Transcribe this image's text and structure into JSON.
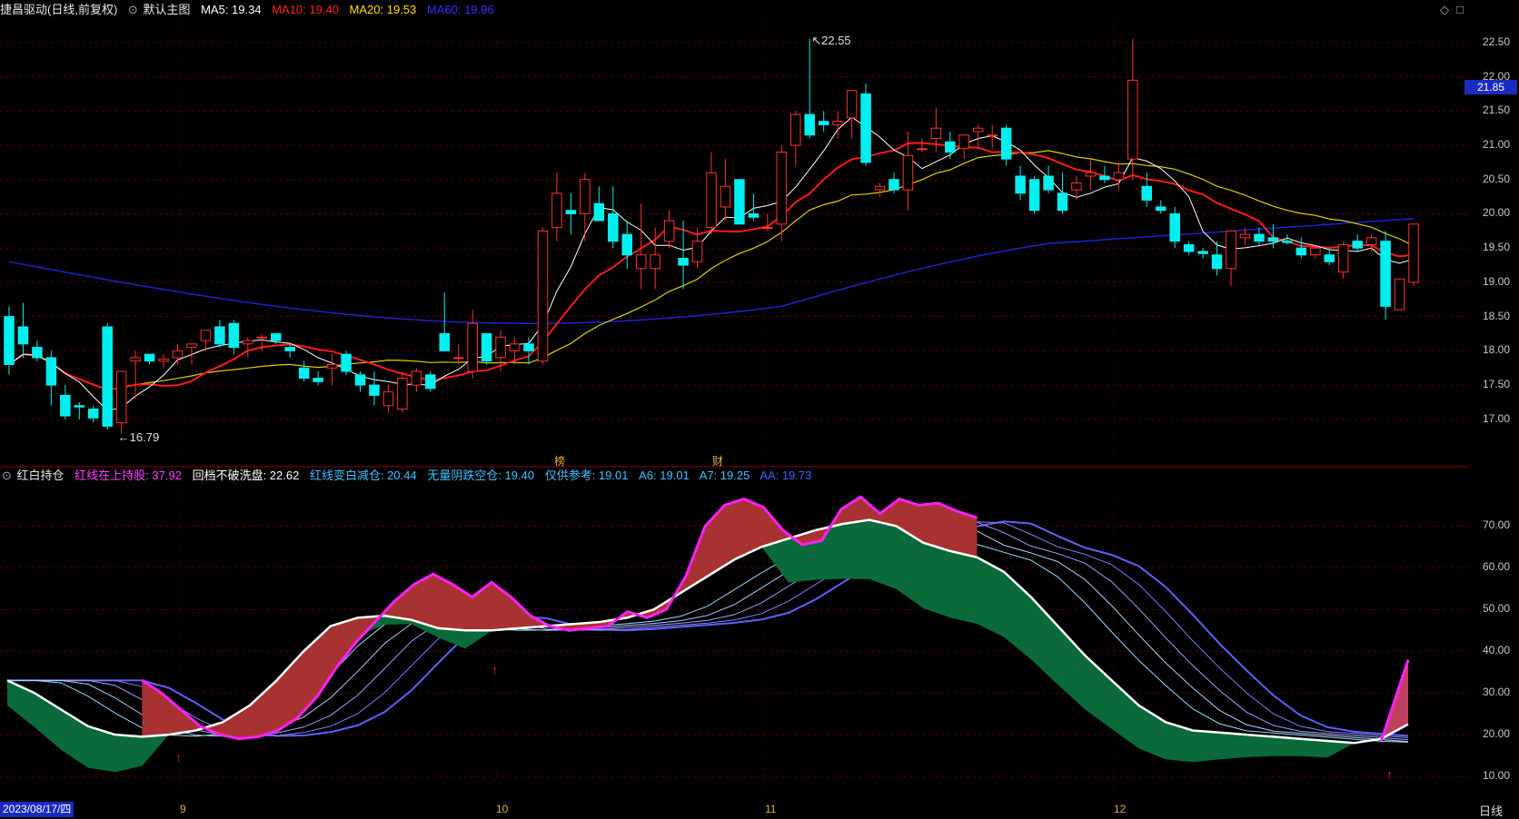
{
  "main_header": {
    "stock_title": "捷昌驱动(日线,前复权)",
    "template": "默认主图",
    "ma5": "MA5: 19.34",
    "ma10": "MA10: 19.40",
    "ma20": "MA20: 19.53",
    "ma60": "MA60: 19.96",
    "colors": {
      "ma5": "#ffffff",
      "ma10": "#ff2020",
      "ma20": "#ffe000",
      "ma60": "#3030ff"
    }
  },
  "main_axis": {
    "ticks": [
      "22.50",
      "22.00",
      "21.50",
      "21.00",
      "20.50",
      "20.00",
      "19.50",
      "19.00",
      "18.50",
      "18.00",
      "17.50",
      "17.00"
    ],
    "current_price": "21.85"
  },
  "annotations": {
    "high_label": "22.55",
    "low_label": "16.79",
    "marker_bang": "榜",
    "marker_cai": "财"
  },
  "indicator_header": {
    "name": "红白持仓",
    "hold": "红线在上持股: 37.92",
    "pullback": "回档不破洗盘: 22.62",
    "reduce": "红线变白减仓: 20.44",
    "empty": "无量阴跌空仓: 19.40",
    "ref": "仅供参考: 19.01",
    "a6": "A6: 19.01",
    "a7": "A7: 19.25",
    "aa": "AA: 19.73"
  },
  "indicator_axis": {
    "ticks": [
      "70.00",
      "60.00",
      "50.00",
      "40.00",
      "30.00",
      "20.00",
      "10.00"
    ]
  },
  "bottom_bar": {
    "date": "2023/08/17/四",
    "months": [
      "9",
      "10",
      "11",
      "12"
    ],
    "period": "日线"
  },
  "icons": [
    "diamond-icon",
    "maximize-icon",
    "settings-circle-icon",
    "up-arrow-signal-icon"
  ],
  "chart_data": {
    "type": "candlestick",
    "ylim": [
      16.6,
      22.75
    ],
    "candles": [
      [
        18.5,
        18.65,
        17.65,
        17.8
      ],
      [
        18.35,
        18.7,
        17.9,
        18.1
      ],
      [
        18.05,
        18.15,
        17.85,
        17.9
      ],
      [
        17.9,
        18.0,
        17.2,
        17.5
      ],
      [
        17.35,
        17.5,
        17.0,
        17.05
      ],
      [
        17.2,
        17.25,
        17.0,
        17.18
      ],
      [
        17.15,
        17.2,
        16.95,
        17.02
      ],
      [
        18.35,
        18.4,
        16.85,
        16.9
      ],
      [
        16.95,
        17.7,
        16.79,
        17.7
      ],
      [
        17.85,
        18.0,
        17.3,
        17.9
      ],
      [
        17.95,
        17.95,
        17.8,
        17.85
      ],
      [
        17.85,
        17.95,
        17.75,
        17.88
      ],
      [
        17.9,
        18.1,
        17.8,
        18.0
      ],
      [
        18.05,
        18.1,
        17.8,
        18.1
      ],
      [
        18.15,
        18.3,
        18.0,
        18.3
      ],
      [
        18.35,
        18.45,
        18.05,
        18.1
      ],
      [
        18.4,
        18.45,
        17.95,
        18.05
      ],
      [
        18.1,
        18.2,
        17.9,
        18.15
      ],
      [
        18.2,
        18.25,
        18.0,
        18.2
      ],
      [
        18.25,
        18.25,
        18.1,
        18.15
      ],
      [
        18.05,
        18.1,
        17.9,
        18.0
      ],
      [
        17.75,
        17.85,
        17.55,
        17.6
      ],
      [
        17.6,
        17.7,
        17.5,
        17.55
      ],
      [
        17.75,
        17.95,
        17.5,
        17.8
      ],
      [
        17.95,
        18.0,
        17.65,
        17.7
      ],
      [
        17.65,
        17.7,
        17.4,
        17.5
      ],
      [
        17.5,
        17.7,
        17.2,
        17.35
      ],
      [
        17.2,
        17.5,
        17.1,
        17.4
      ],
      [
        17.15,
        17.7,
        17.1,
        17.6
      ],
      [
        17.5,
        17.75,
        17.4,
        17.7
      ],
      [
        17.65,
        17.7,
        17.4,
        17.45
      ],
      [
        18.25,
        18.85,
        18.1,
        18.0
      ],
      [
        17.9,
        18.1,
        17.8,
        17.9
      ],
      [
        17.7,
        18.6,
        17.6,
        18.4
      ],
      [
        18.25,
        18.25,
        17.8,
        17.85
      ],
      [
        17.9,
        18.3,
        17.7,
        18.2
      ],
      [
        18.0,
        18.2,
        17.8,
        18.1
      ],
      [
        18.1,
        18.2,
        17.8,
        18.0
      ],
      [
        17.85,
        19.8,
        17.8,
        19.75
      ],
      [
        19.8,
        20.6,
        19.6,
        20.3
      ],
      [
        20.05,
        20.3,
        19.7,
        20.0
      ],
      [
        20.0,
        20.6,
        19.6,
        20.5
      ],
      [
        20.15,
        20.4,
        19.9,
        19.9
      ],
      [
        20.0,
        20.4,
        19.5,
        19.6
      ],
      [
        19.7,
        19.9,
        19.2,
        19.4
      ],
      [
        19.2,
        20.15,
        18.9,
        19.4
      ],
      [
        19.2,
        19.8,
        18.9,
        19.4
      ],
      [
        19.6,
        20.05,
        19.5,
        19.9
      ],
      [
        19.35,
        19.9,
        18.9,
        19.25
      ],
      [
        19.3,
        19.8,
        19.2,
        19.6
      ],
      [
        19.8,
        20.9,
        19.7,
        20.6
      ],
      [
        20.1,
        20.8,
        19.9,
        20.4
      ],
      [
        20.5,
        20.5,
        19.85,
        19.85
      ],
      [
        20.0,
        20.3,
        19.9,
        19.95
      ],
      [
        19.8,
        20.0,
        19.75,
        19.8
      ],
      [
        19.85,
        21.0,
        19.6,
        20.9
      ],
      [
        21.0,
        21.5,
        20.7,
        21.45
      ],
      [
        21.45,
        22.55,
        21.1,
        21.15
      ],
      [
        21.35,
        21.5,
        21.2,
        21.3
      ],
      [
        21.3,
        21.5,
        21.1,
        21.35
      ],
      [
        21.4,
        21.75,
        21.1,
        21.8
      ],
      [
        21.75,
        21.9,
        20.7,
        20.75
      ],
      [
        20.35,
        20.45,
        20.25,
        20.4
      ],
      [
        20.5,
        20.6,
        20.3,
        20.35
      ],
      [
        20.35,
        21.2,
        20.05,
        20.85
      ],
      [
        20.95,
        21.1,
        20.9,
        20.95
      ],
      [
        21.1,
        21.55,
        20.9,
        21.25
      ],
      [
        21.05,
        21.2,
        20.8,
        20.9
      ],
      [
        20.95,
        21.15,
        20.8,
        21.15
      ],
      [
        21.2,
        21.3,
        20.95,
        21.25
      ],
      [
        21.15,
        21.3,
        20.95,
        21.15
      ],
      [
        21.25,
        21.3,
        20.7,
        20.8
      ],
      [
        20.55,
        20.7,
        20.2,
        20.3
      ],
      [
        20.5,
        20.55,
        20.0,
        20.05
      ],
      [
        20.55,
        20.7,
        20.3,
        20.35
      ],
      [
        20.3,
        20.6,
        20.0,
        20.05
      ],
      [
        20.35,
        20.55,
        20.2,
        20.45
      ],
      [
        20.55,
        20.8,
        20.35,
        20.6
      ],
      [
        20.55,
        20.7,
        20.45,
        20.5
      ],
      [
        20.5,
        20.75,
        20.35,
        20.6
      ],
      [
        20.8,
        22.55,
        20.5,
        21.95
      ],
      [
        20.4,
        20.6,
        20.1,
        20.2
      ],
      [
        20.1,
        20.2,
        20.0,
        20.05
      ],
      [
        20.0,
        20.1,
        19.5,
        19.6
      ],
      [
        19.55,
        19.6,
        19.4,
        19.45
      ],
      [
        19.45,
        19.5,
        19.35,
        19.42
      ],
      [
        19.4,
        19.6,
        19.1,
        19.2
      ],
      [
        19.2,
        19.75,
        18.95,
        19.75
      ],
      [
        19.65,
        19.8,
        19.55,
        19.7
      ],
      [
        19.7,
        19.8,
        19.55,
        19.6
      ],
      [
        19.65,
        19.85,
        19.5,
        19.6
      ],
      [
        19.6,
        19.7,
        19.55,
        19.58
      ],
      [
        19.5,
        19.65,
        19.35,
        19.4
      ],
      [
        19.4,
        19.55,
        19.35,
        19.5
      ],
      [
        19.4,
        19.5,
        19.25,
        19.3
      ],
      [
        19.15,
        19.6,
        19.05,
        19.55
      ],
      [
        19.6,
        19.7,
        19.45,
        19.5
      ],
      [
        19.55,
        19.7,
        19.45,
        19.65
      ],
      [
        19.6,
        19.75,
        18.45,
        18.65
      ],
      [
        18.6,
        18.6,
        18.6,
        19.05
      ],
      [
        19.0,
        19.85,
        18.95,
        19.85
      ]
    ],
    "indicator_ylim": [
      5,
      79
    ],
    "indicator_red_line": [
      33,
      30,
      26,
      22,
      20,
      19,
      19.5,
      21,
      24,
      29,
      36,
      42,
      47,
      52,
      56,
      58.5,
      56,
      53,
      56.5,
      53,
      48.5,
      46,
      45,
      45.5,
      46,
      49.5,
      48,
      50,
      58,
      70,
      75,
      76.5,
      74.5,
      69,
      65.5,
      66.5,
      74,
      77,
      73,
      76.5,
      75,
      75.5,
      73.5,
      72
    ],
    "indicator_white_line": [
      33,
      30,
      26,
      22,
      20,
      19.5,
      20,
      21,
      23,
      27,
      33,
      40,
      46,
      48,
      48.5,
      47.5,
      45.5,
      45,
      45,
      45.5,
      46,
      46.5,
      47,
      48,
      50,
      54,
      58,
      62,
      65,
      67,
      69,
      70.5,
      71.5,
      70,
      66,
      64,
      62.5,
      59,
      53,
      46,
      39,
      33,
      27,
      23,
      21,
      20.5,
      20,
      19.5,
      19,
      18.5,
      18,
      19,
      22.5
    ]
  }
}
